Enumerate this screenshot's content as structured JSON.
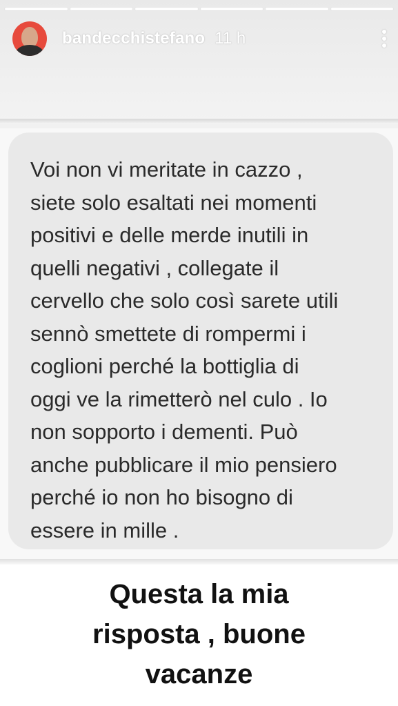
{
  "story": {
    "username": "bandecchistefano",
    "time_ago": "11 h",
    "progress_segments": 6,
    "more_icon": "more-vertical-icon",
    "avatar_icon": "profile-avatar"
  },
  "message": {
    "lines": "Voi non vi meritate in cazzo ,\nsiete solo esaltati nei momenti\npositivi e delle merde inutili in\nquelli negativi , collegate il\ncervello che solo così sarete utili\nsennò smettete di rompermi i\ncoglioni perché la bottiglia di\noggi ve la rimetterò nel culo . Io\nnon sopporto i dementi. Può\nanche pubblicare il mio pensiero\nperché io non ho bisogno di\nessere in mille ."
  },
  "reply": {
    "text": "Questa la mia\nrisposta , buone\nvacanze"
  },
  "colors": {
    "bubble_bg": "#e9e9e9",
    "text": "#2a2a2a",
    "avatar_bg": "#e74a3c"
  }
}
